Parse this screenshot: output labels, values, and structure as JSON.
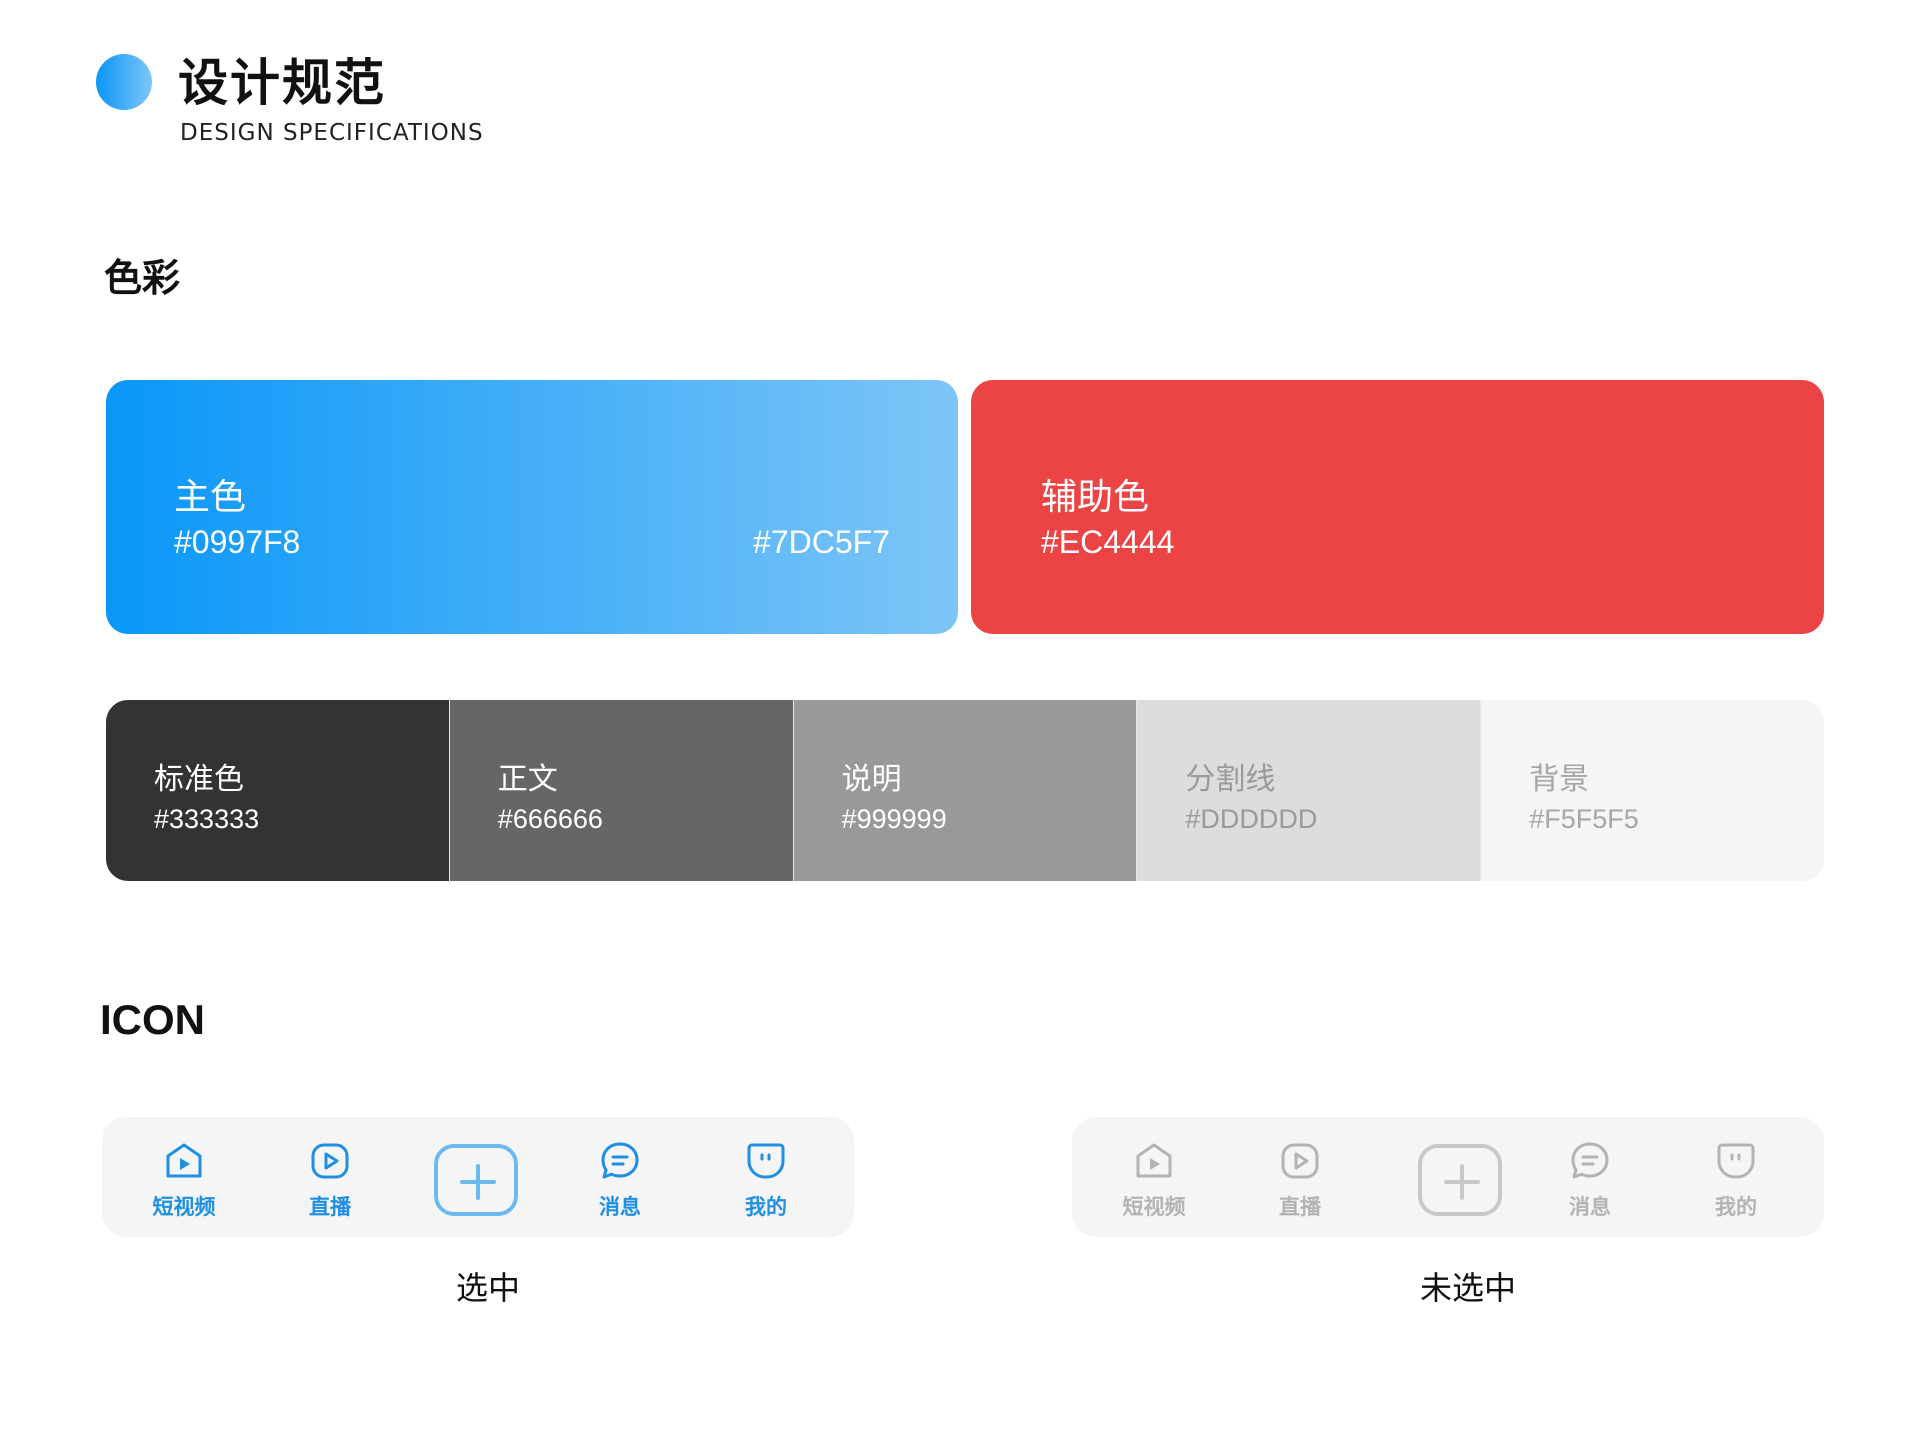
{
  "header": {
    "title": "设计规范",
    "subtitle": "DESIGN SPECIFICATIONS"
  },
  "sections": {
    "colors_title": "色彩",
    "icons_title": "ICON"
  },
  "colors": {
    "primary": {
      "label": "主色",
      "hex_start": "#0997F8",
      "hex_end": "#7DC5F7",
      "color_start": "#0997F8",
      "color_end": "#7DC5F7"
    },
    "secondary": {
      "label": "辅助色",
      "hex": "#EC4444",
      "color": "#EC4444"
    },
    "neutrals": [
      {
        "label": "标准色",
        "hex": "#333333",
        "color": "#333333",
        "text_color": "#ffffff"
      },
      {
        "label": "正文",
        "hex": "#666666",
        "color": "#666666",
        "text_color": "#ffffff"
      },
      {
        "label": "说明",
        "hex": "#999999",
        "color": "#999999",
        "text_color": "#ffffff"
      },
      {
        "label": "分割线",
        "hex": "#DDDDDD",
        "color": "#DDDDDD",
        "text_color": "#9a9a9a"
      },
      {
        "label": "背景",
        "hex": "#F5F5F5",
        "color": "#F5F5F5",
        "text_color": "#a6a6a6"
      }
    ]
  },
  "tabbars": {
    "selected": {
      "caption": "选中",
      "color": "#1E8FE1",
      "add_color": "#6CB9EE",
      "tabs": [
        {
          "label": "短视频",
          "icon": "home-play-icon"
        },
        {
          "label": "直播",
          "icon": "live-play-icon"
        },
        {
          "label": "",
          "icon": "add-icon"
        },
        {
          "label": "消息",
          "icon": "message-icon"
        },
        {
          "label": "我的",
          "icon": "profile-icon"
        }
      ]
    },
    "unselected": {
      "caption": "未选中",
      "color": "#B3B3B3",
      "add_color": "#C8C8C8",
      "tabs": [
        {
          "label": "短视频",
          "icon": "home-play-icon"
        },
        {
          "label": "直播",
          "icon": "live-play-icon"
        },
        {
          "label": "",
          "icon": "add-icon"
        },
        {
          "label": "消息",
          "icon": "message-icon"
        },
        {
          "label": "我的",
          "icon": "profile-icon"
        }
      ]
    }
  }
}
